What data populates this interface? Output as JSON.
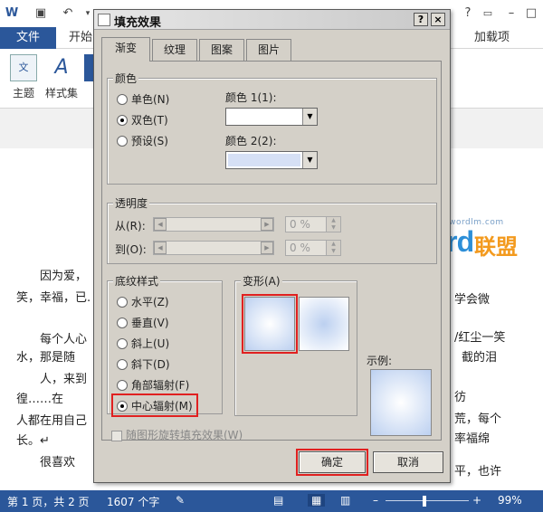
{
  "word": {
    "file_tab": "文件",
    "start_tab": "开始",
    "addins_tab": "加载项",
    "ribbon": {
      "theme_label": "主题",
      "styleset_label": "样式集",
      "theme_icon_text": "文",
      "styleset_icon_text": "A"
    },
    "document_lines": [
      "因为爱，",
      "笑，幸福，已.",
      "每个人心",
      "水，那是随",
      "人，来到",
      "徨……在",
      "人都在用自己",
      "长。↵",
      "很喜欢"
    ],
    "document_right_lines": [
      "学会微",
      "/红尘一笑",
      "截的泪",
      "彷",
      "荒，每个",
      "率福绵",
      "平，也许"
    ],
    "status": {
      "page": "第 1 页，共 2 页",
      "words": "1607 个字",
      "zoom": "99%"
    }
  },
  "watermark": {
    "url": "www.wordlm.com",
    "word": "Word",
    "lianmeng": "联盟"
  },
  "dialog": {
    "title": "填充效果",
    "help_btn": "?",
    "close_btn": "×",
    "tabs": [
      "渐变",
      "纹理",
      "图案",
      "图片"
    ],
    "colors_group": {
      "title": "颜色",
      "options": [
        "单色(N)",
        "双色(T)",
        "预设(S)"
      ],
      "selected": 1,
      "color1_label": "颜色 1(1):",
      "color2_label": "颜色 2(2):",
      "color1_value": "#ffffff",
      "color2_value": "#d6e0f5"
    },
    "transparency_group": {
      "title": "透明度",
      "from_label": "从(R):",
      "to_label": "到(O):",
      "from_value": "0 %",
      "to_value": "0 %"
    },
    "shading_group": {
      "title": "底纹样式",
      "options": [
        "水平(Z)",
        "垂直(V)",
        "斜上(U)",
        "斜下(D)",
        "角部辐射(F)",
        "中心辐射(M)"
      ],
      "selected": 5
    },
    "variants_group": {
      "title": "变形(A)"
    },
    "sample_label": "示例:",
    "rotate_checkbox": "随图形旋转填充效果(W)",
    "ok_button": "确定",
    "cancel_button": "取消",
    "colors": {
      "dialog_bg": "#d4d0c8",
      "gradient_light": "#ffffff",
      "gradient_dark": "#bcd0f0",
      "highlight": "#e02020",
      "word_blue": "#2b579a"
    }
  }
}
